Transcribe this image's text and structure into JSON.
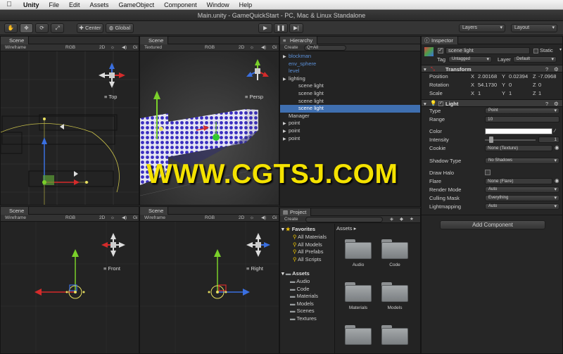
{
  "menubar": {
    "items": [
      "Unity",
      "File",
      "Edit",
      "Assets",
      "GameObject",
      "Component",
      "Window",
      "Help"
    ]
  },
  "window": {
    "title": "Main.unity - GameQuickStart - PC, Mac & Linux Standalone"
  },
  "toolbar": {
    "pivot_label": "Center",
    "space_label": "Global",
    "layers_label": "Layers",
    "layout_label": "Layout"
  },
  "scene_views": [
    {
      "tab": "Scene",
      "mode": "Wireframe",
      "channel": "RGB",
      "dim": "2D",
      "gizmos": "Gi",
      "view_label": "Top"
    },
    {
      "tab": "Scene",
      "mode": "Textured",
      "channel": "RGB",
      "dim": "2D",
      "gizmos": "Gi",
      "view_label": "Persp"
    },
    {
      "tab": "Scene",
      "mode": "Wireframe",
      "channel": "RGB",
      "dim": "2D",
      "gizmos": "Gi",
      "view_label": "Front"
    },
    {
      "tab": "Scene",
      "mode": "Wireframe",
      "channel": "RGB",
      "dim": "2D",
      "gizmos": "Gi",
      "view_label": "Right"
    }
  ],
  "hierarchy": {
    "tab": "Hierarchy",
    "create_label": "Create",
    "search_placeholder": "Q+All",
    "items": [
      {
        "label": "blockman",
        "indent": 0,
        "arrow": true,
        "prefab": true,
        "selected": false
      },
      {
        "label": "env_sphere",
        "indent": 0,
        "arrow": false,
        "prefab": true,
        "selected": false
      },
      {
        "label": "level",
        "indent": 0,
        "arrow": false,
        "prefab": true,
        "selected": false
      },
      {
        "label": "lighting",
        "indent": 0,
        "arrow": true,
        "prefab": false,
        "selected": false
      },
      {
        "label": "scene light",
        "indent": 1,
        "arrow": false,
        "prefab": false,
        "selected": false
      },
      {
        "label": "scene light",
        "indent": 1,
        "arrow": false,
        "prefab": false,
        "selected": false
      },
      {
        "label": "scene light",
        "indent": 1,
        "arrow": false,
        "prefab": false,
        "selected": false
      },
      {
        "label": "scene light",
        "indent": 1,
        "arrow": false,
        "prefab": false,
        "selected": true
      },
      {
        "label": "Manager",
        "indent": 0,
        "arrow": false,
        "prefab": false,
        "selected": false
      },
      {
        "label": "point",
        "indent": 0,
        "arrow": true,
        "prefab": false,
        "selected": false
      },
      {
        "label": "point",
        "indent": 0,
        "arrow": true,
        "prefab": false,
        "selected": false
      },
      {
        "label": "point",
        "indent": 0,
        "arrow": true,
        "prefab": false,
        "selected": false
      }
    ]
  },
  "inspector": {
    "tab": "Inspector",
    "object_name": "scene light",
    "static_label": "Static",
    "tag_label": "Tag",
    "tag_value": "Untagged",
    "layer_label": "Layer",
    "layer_value": "Default",
    "transform": {
      "title": "Transform",
      "position_label": "Position",
      "position": {
        "x": "2.00168",
        "y": "0.02394",
        "z": "-7.0968"
      },
      "rotation_label": "Rotation",
      "rotation": {
        "x": "54.1730",
        "y": "0",
        "z": "0"
      },
      "scale_label": "Scale",
      "scale": {
        "x": "1",
        "y": "1",
        "z": "1"
      }
    },
    "light": {
      "title": "Light",
      "type_label": "Type",
      "type_value": "Point",
      "range_label": "Range",
      "range_value": "10",
      "color_label": "Color",
      "color_value": "#ffffff",
      "intensity_label": "Intensity",
      "intensity_value": "1",
      "intensity_fraction": 0.125,
      "cookie_label": "Cookie",
      "cookie_value": "None (Texture)",
      "shadow_label": "Shadow Type",
      "shadow_value": "No Shadows",
      "halo_label": "Draw Halo",
      "flare_label": "Flare",
      "flare_value": "None (Flare)",
      "render_mode_label": "Render Mode",
      "render_mode_value": "Auto",
      "culling_label": "Culling Mask",
      "culling_value": "Everything",
      "lightmapping_label": "Lightmapping",
      "lightmapping_value": "Auto"
    },
    "add_component_label": "Add Component"
  },
  "project": {
    "tab": "Project",
    "create_label": "Create",
    "breadcrumb": "Assets",
    "favorites_label": "Favorites",
    "favorites": [
      "All Materials",
      "All Models",
      "All Prefabs",
      "All Scripts"
    ],
    "assets_label": "Assets",
    "assets_tree": [
      "Audio",
      "Code",
      "Materials",
      "Models",
      "Scenes",
      "Textures"
    ],
    "grid": [
      "Audio",
      "Code",
      "Materials",
      "Models",
      "",
      ""
    ]
  },
  "watermark": "WWW.CGTSJ.COM",
  "colors": {
    "selection": "#3f6fb0",
    "prefab_text": "#5b8fd6",
    "watermark": "#f4e200",
    "axis_x": "#d42b2b",
    "axis_y": "#7ad02a",
    "axis_z": "#3a6fe0"
  }
}
